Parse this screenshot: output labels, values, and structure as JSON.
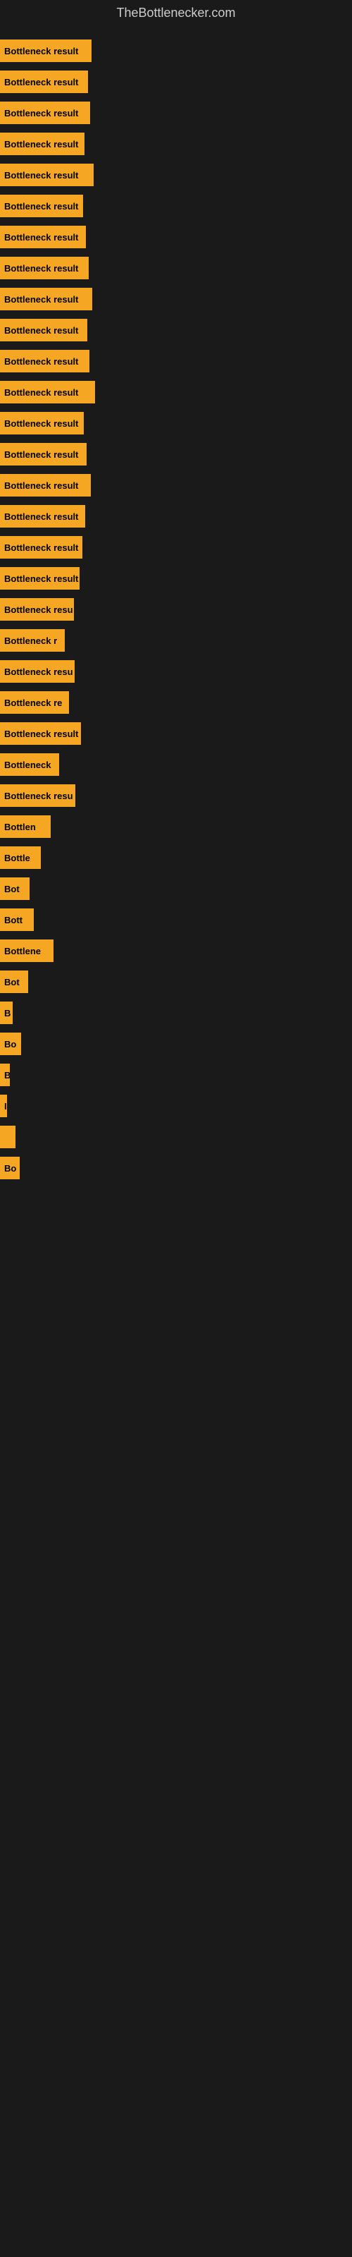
{
  "site_title": "TheBottlenecker.com",
  "bars": [
    {
      "label": "Bottleneck result",
      "width": 130
    },
    {
      "label": "Bottleneck result",
      "width": 125
    },
    {
      "label": "Bottleneck result",
      "width": 128
    },
    {
      "label": "Bottleneck result",
      "width": 120
    },
    {
      "label": "Bottleneck result",
      "width": 133
    },
    {
      "label": "Bottleneck result",
      "width": 118
    },
    {
      "label": "Bottleneck result",
      "width": 122
    },
    {
      "label": "Bottleneck result",
      "width": 126
    },
    {
      "label": "Bottleneck result",
      "width": 131
    },
    {
      "label": "Bottleneck result",
      "width": 124
    },
    {
      "label": "Bottleneck result",
      "width": 127
    },
    {
      "label": "Bottleneck result",
      "width": 135
    },
    {
      "label": "Bottleneck result",
      "width": 119
    },
    {
      "label": "Bottleneck result",
      "width": 123
    },
    {
      "label": "Bottleneck result",
      "width": 129
    },
    {
      "label": "Bottleneck result",
      "width": 121
    },
    {
      "label": "Bottleneck result",
      "width": 117
    },
    {
      "label": "Bottleneck result",
      "width": 113
    },
    {
      "label": "Bottleneck resu",
      "width": 105
    },
    {
      "label": "Bottleneck r",
      "width": 92
    },
    {
      "label": "Bottleneck resu",
      "width": 106
    },
    {
      "label": "Bottleneck re",
      "width": 98
    },
    {
      "label": "Bottleneck result",
      "width": 115
    },
    {
      "label": "Bottleneck",
      "width": 84
    },
    {
      "label": "Bottleneck resu",
      "width": 107
    },
    {
      "label": "Bottlen",
      "width": 72
    },
    {
      "label": "Bottle",
      "width": 58
    },
    {
      "label": "Bot",
      "width": 42
    },
    {
      "label": "Bott",
      "width": 48
    },
    {
      "label": "Bottlene",
      "width": 76
    },
    {
      "label": "Bot",
      "width": 40
    },
    {
      "label": "B",
      "width": 18
    },
    {
      "label": "Bo",
      "width": 30
    },
    {
      "label": "B",
      "width": 14
    },
    {
      "label": "I",
      "width": 10
    },
    {
      "label": "",
      "width": 22
    },
    {
      "label": "Bo",
      "width": 28
    }
  ]
}
